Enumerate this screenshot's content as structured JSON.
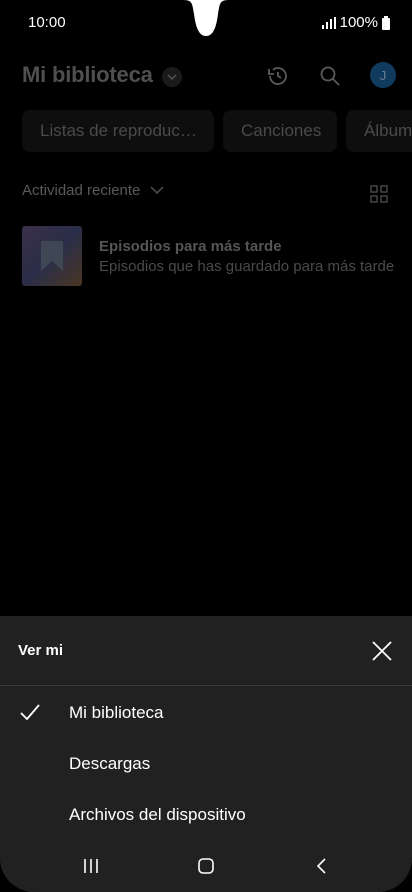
{
  "status_bar": {
    "time": "10:00",
    "battery": "100%"
  },
  "header": {
    "title": "Mi biblioteca",
    "avatar_initial": "J"
  },
  "chips": [
    "Listas de reproduc…",
    "Canciones",
    "Álbum"
  ],
  "recent": {
    "label": "Actividad reciente"
  },
  "library_item": {
    "title": "Episodios para más tarde",
    "subtitle": "Episodios que has guardado para más tarde"
  },
  "sheet": {
    "title": "Ver mi",
    "options": [
      {
        "label": "Mi biblioteca",
        "selected": true
      },
      {
        "label": "Descargas",
        "selected": false
      },
      {
        "label": "Archivos del dispositivo",
        "selected": false
      }
    ]
  },
  "colors": {
    "sheet_bg": "#212121",
    "avatar_bg": "#113a5f",
    "background": "#000000"
  }
}
